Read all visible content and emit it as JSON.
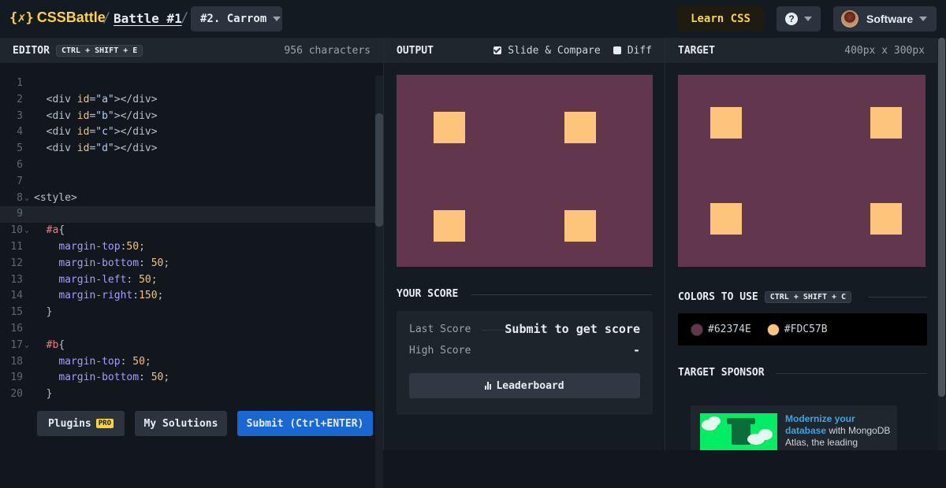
{
  "header": {
    "logo_mark": "{✗}",
    "logo_text": "CSSBattle",
    "sep": "/",
    "battle": "Battle #1",
    "target_select": "#2. Carrom",
    "learn": "Learn CSS",
    "help": "?",
    "user": "Software"
  },
  "editor": {
    "title": "EDITOR",
    "shortcut": "CTRL + SHIFT + E",
    "char_count": "956 characters",
    "plugins_label": "Plugins",
    "pro_badge": "PRO",
    "solutions_label": "My Solutions",
    "submit_label": "Submit (Ctrl+ENTER)"
  },
  "code_lines": [
    {
      "n": "1",
      "fold": "",
      "tokens": []
    },
    {
      "n": "2",
      "fold": "",
      "tokens": [
        [
          "tag",
          "<div "
        ],
        [
          "attr",
          "id"
        ],
        [
          "tag",
          "="
        ],
        [
          "str",
          "\"a\""
        ],
        [
          "tag",
          "></div>"
        ]
      ],
      "indent": "  "
    },
    {
      "n": "3",
      "fold": "",
      "tokens": [
        [
          "tag",
          "<div "
        ],
        [
          "attr",
          "id"
        ],
        [
          "tag",
          "="
        ],
        [
          "str",
          "\"b\""
        ],
        [
          "tag",
          "></div>"
        ]
      ],
      "indent": "  "
    },
    {
      "n": "4",
      "fold": "",
      "tokens": [
        [
          "tag",
          "<div "
        ],
        [
          "attr",
          "id"
        ],
        [
          "tag",
          "="
        ],
        [
          "str",
          "\"c\""
        ],
        [
          "tag",
          "></div>"
        ]
      ],
      "indent": "  "
    },
    {
      "n": "5",
      "fold": "",
      "tokens": [
        [
          "tag",
          "<div "
        ],
        [
          "attr",
          "id"
        ],
        [
          "tag",
          "="
        ],
        [
          "str",
          "\"d\""
        ],
        [
          "tag",
          "></div>"
        ]
      ],
      "indent": "  "
    },
    {
      "n": "6",
      "fold": "",
      "tokens": []
    },
    {
      "n": "7",
      "fold": "",
      "tokens": []
    },
    {
      "n": "8",
      "fold": "⌄",
      "tokens": [
        [
          "tag",
          "<style>"
        ]
      ],
      "indent": ""
    },
    {
      "n": "9",
      "fold": "",
      "tokens": [],
      "active": true
    },
    {
      "n": "10",
      "fold": "⌄",
      "tokens": [
        [
          "sel",
          "#a"
        ],
        [
          "tag",
          "{"
        ]
      ],
      "indent": "  "
    },
    {
      "n": "11",
      "fold": "",
      "tokens": [
        [
          "prop",
          "margin-top"
        ],
        [
          "tag",
          ":"
        ],
        [
          "num",
          "50"
        ],
        [
          "tag",
          ";"
        ]
      ],
      "indent": "    "
    },
    {
      "n": "12",
      "fold": "",
      "tokens": [
        [
          "prop",
          "margin-bottom"
        ],
        [
          "tag",
          ": "
        ],
        [
          "num",
          "50"
        ],
        [
          "tag",
          ";"
        ]
      ],
      "indent": "    "
    },
    {
      "n": "13",
      "fold": "",
      "tokens": [
        [
          "prop",
          "margin-left"
        ],
        [
          "tag",
          ": "
        ],
        [
          "num",
          "50"
        ],
        [
          "tag",
          ";"
        ]
      ],
      "indent": "    "
    },
    {
      "n": "14",
      "fold": "",
      "tokens": [
        [
          "prop",
          "margin-right"
        ],
        [
          "tag",
          ":"
        ],
        [
          "num",
          "150"
        ],
        [
          "tag",
          ";"
        ]
      ],
      "indent": "    "
    },
    {
      "n": "15",
      "fold": "",
      "tokens": [
        [
          "tag",
          "}"
        ]
      ],
      "indent": "  "
    },
    {
      "n": "16",
      "fold": "",
      "tokens": []
    },
    {
      "n": "17",
      "fold": "⌄",
      "tokens": [
        [
          "sel",
          "#b"
        ],
        [
          "tag",
          "{"
        ]
      ],
      "indent": "  "
    },
    {
      "n": "18",
      "fold": "",
      "tokens": [
        [
          "prop",
          "margin-top"
        ],
        [
          "tag",
          ": "
        ],
        [
          "num",
          "50"
        ],
        [
          "tag",
          ";"
        ]
      ],
      "indent": "    "
    },
    {
      "n": "19",
      "fold": "",
      "tokens": [
        [
          "prop",
          "margin-bottom"
        ],
        [
          "tag",
          ": "
        ],
        [
          "num",
          "50"
        ],
        [
          "tag",
          ";"
        ]
      ],
      "indent": "    "
    },
    {
      "n": "20",
      "fold": "",
      "tokens": [
        [
          "tag",
          "}"
        ]
      ],
      "indent": "  "
    }
  ],
  "output": {
    "title": "OUTPUT",
    "slide_compare": "Slide & Compare",
    "diff": "Diff",
    "score_title": "YOUR SCORE",
    "last_score_label": "Last Score",
    "last_score_value": "Submit to get score",
    "high_score_label": "High Score",
    "high_score_value": "-",
    "leaderboard": "Leaderboard"
  },
  "target": {
    "title": "TARGET",
    "dimensions": "400px x 300px",
    "colors_title": "COLORS TO USE",
    "colors_shortcut": "CTRL + SHIFT + C",
    "colors": [
      {
        "hex": "#62374E",
        "label": "#62374E"
      },
      {
        "hex": "#FDC57B",
        "label": "#FDC57B"
      }
    ],
    "sponsor_title": "TARGET SPONSOR",
    "ad_headline": "Modernize your database",
    "ad_body": " with MongoDB Atlas, the leading"
  },
  "theme": {
    "background_color": "#62374E",
    "square_color": "#FDC57B",
    "accent": "#FBD33E",
    "submit_blue": "#1967D2"
  }
}
